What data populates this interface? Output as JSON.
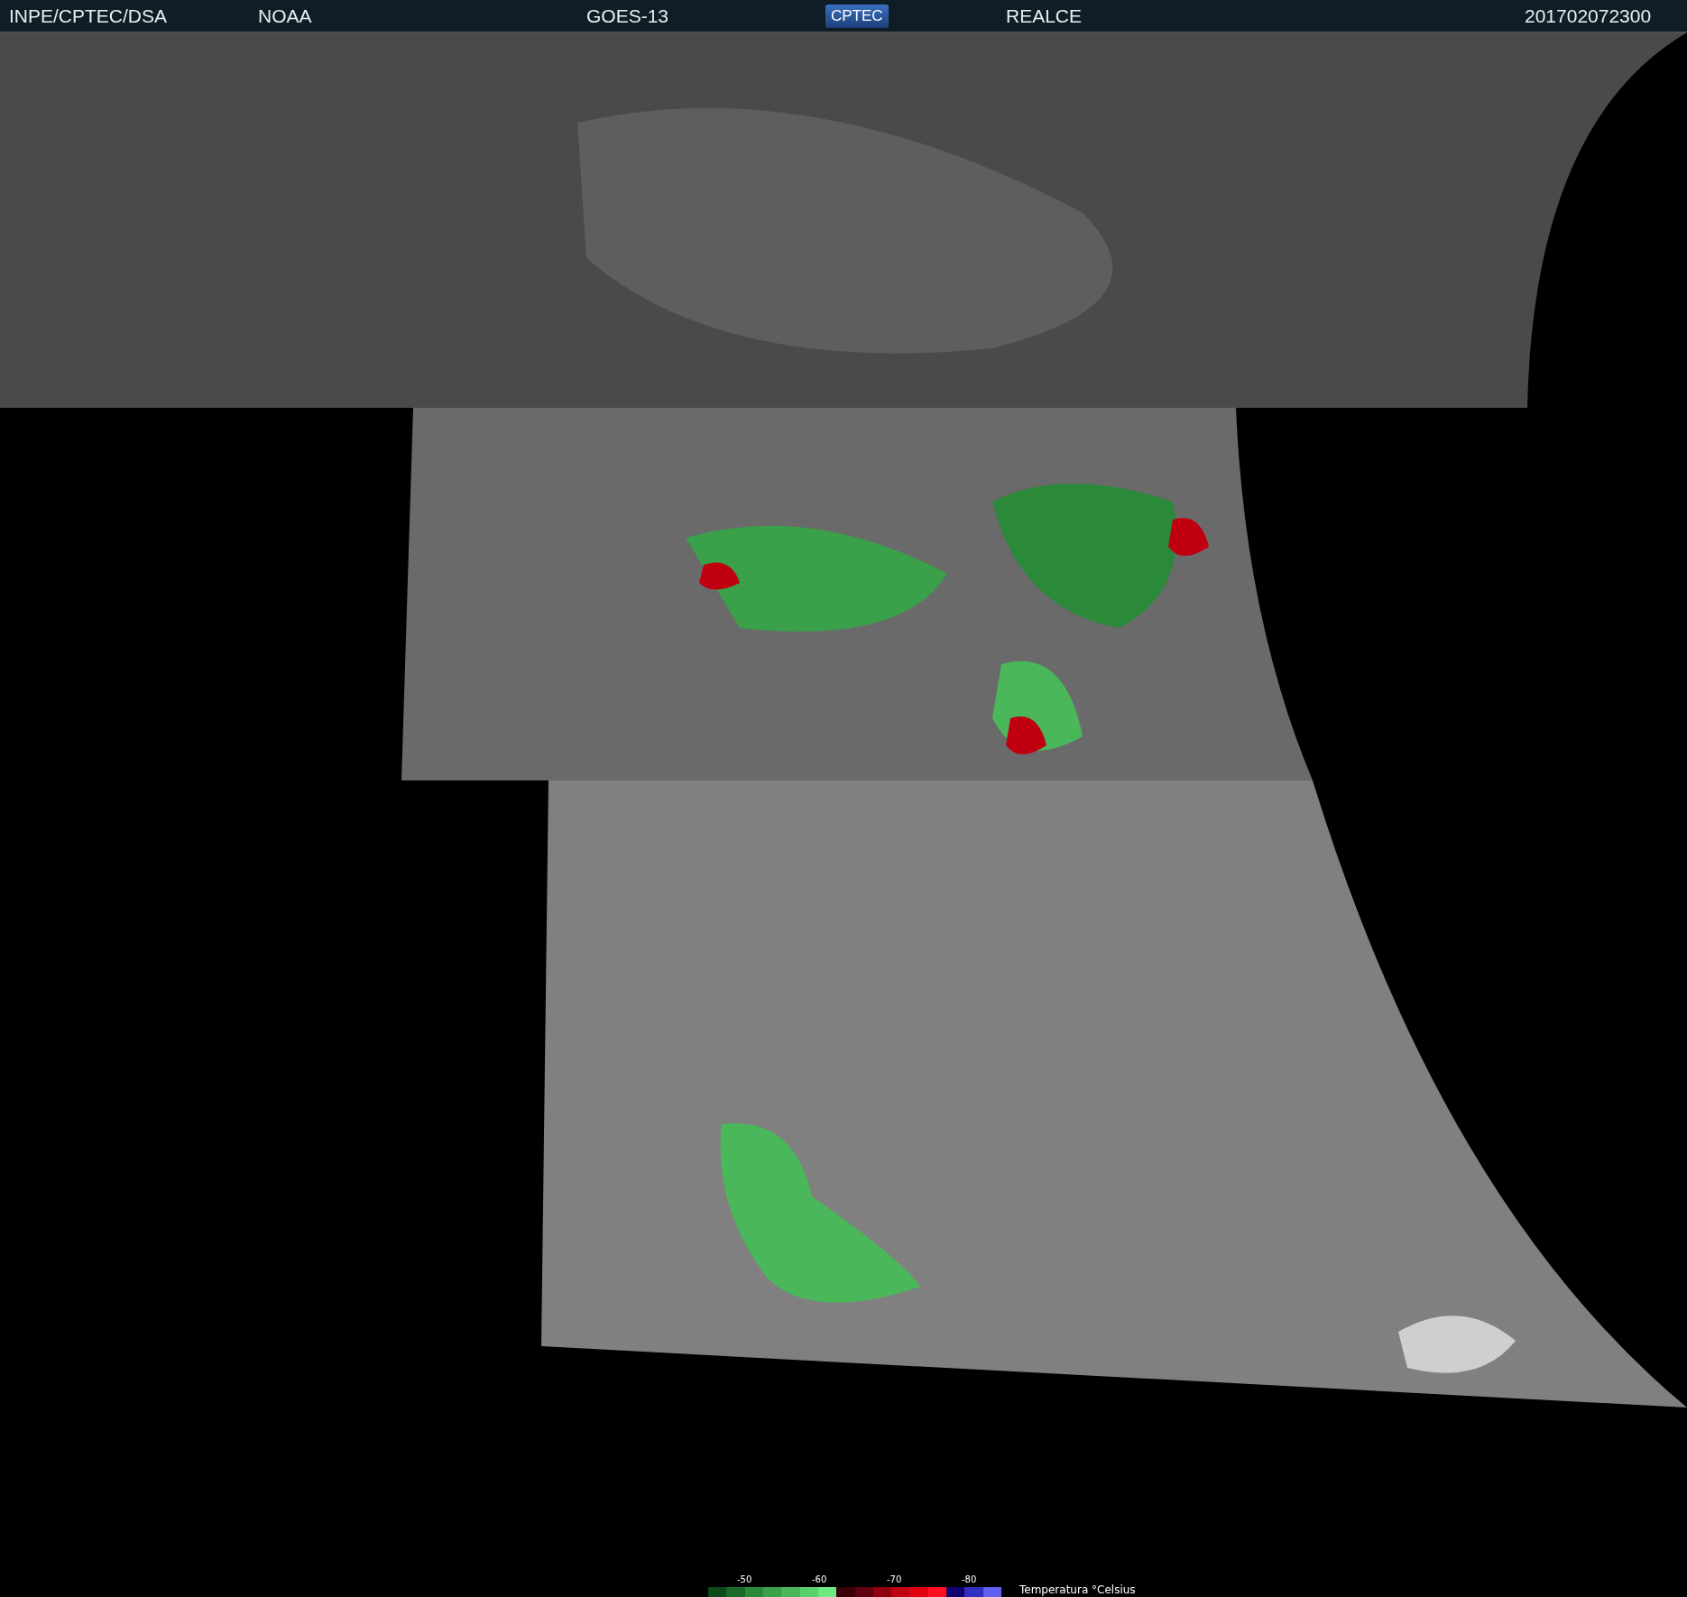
{
  "header": {
    "items": [
      {
        "kind": "text",
        "text": "INPE/CPTEC/DSA"
      },
      {
        "kind": "text",
        "text": "NOAA"
      },
      {
        "kind": "text",
        "text": "GOES-13"
      },
      {
        "kind": "logo",
        "text": "CPTEC"
      },
      {
        "kind": "text",
        "text": "REALCE"
      },
      {
        "kind": "text",
        "text": "201702072300"
      }
    ]
  },
  "legend": {
    "title": "Temperatura °Celsius",
    "ticks": [
      "-50",
      "-60",
      "-70",
      "-80"
    ],
    "swatches": [
      {
        "color": "#0b4a1a"
      },
      {
        "color": "#1a6a2a"
      },
      {
        "color": "#2a8a3a"
      },
      {
        "color": "#3aa04a"
      },
      {
        "color": "#4ab85a"
      },
      {
        "color": "#5ad06a"
      },
      {
        "color": "#70e880"
      },
      {
        "color": "#3a0008"
      },
      {
        "color": "#600010"
      },
      {
        "color": "#900010"
      },
      {
        "color": "#c00010"
      },
      {
        "color": "#e00010"
      },
      {
        "color": "#ff1020"
      },
      {
        "color": "#100070"
      },
      {
        "color": "#3030c0"
      },
      {
        "color": "#6060f0"
      }
    ]
  }
}
